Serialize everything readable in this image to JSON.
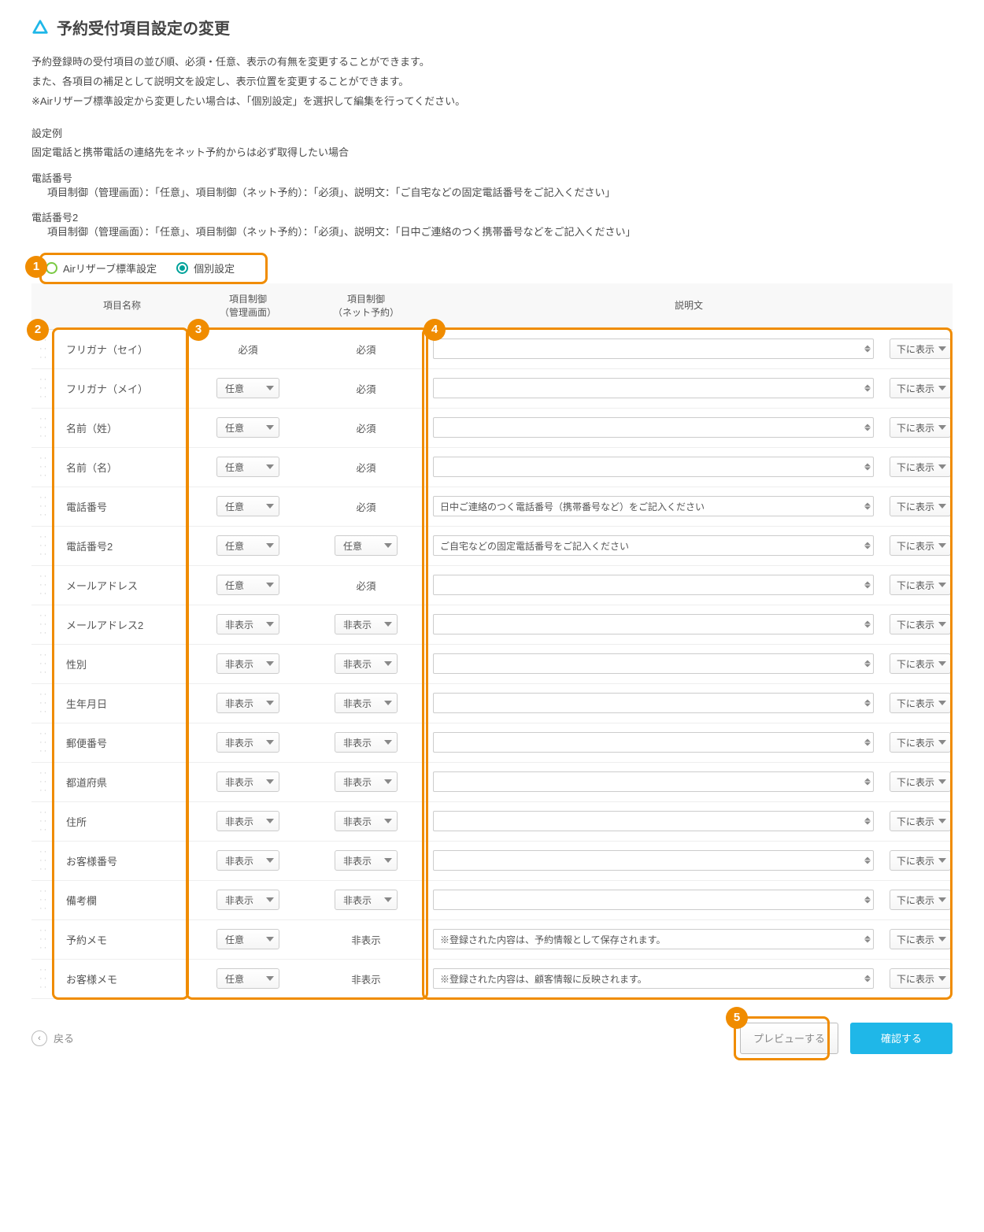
{
  "page_title": "予約受付項目設定の変更",
  "intro_lines": [
    "予約登録時の受付項目の並び順、必須・任意、表示の有無を変更することができます。",
    "また、各項目の補足として説明文を設定し、表示位置を変更することができます。",
    "※Airリザーブ標準設定から変更したい場合は、「個別設定」を選択して編集を行ってください。"
  ],
  "example_heading": "設定例",
  "example_sub": "固定電話と携帯電話の連絡先をネット予約からは必ず取得したい場合",
  "phone_blocks": [
    {
      "title": "電話番号",
      "detail": "項目制御（管理画面）：「任意」、項目制御（ネット予約）：「必須」、説明文：「ご自宅などの固定電話番号をご記入ください」"
    },
    {
      "title": "電話番号2",
      "detail": "項目制御（管理画面）：「任意」、項目制御（ネット予約）：「必須」、説明文：「日中ご連絡のつく携帯番号などをご記入ください」"
    }
  ],
  "radio": {
    "standard": "Airリザーブ標準設定",
    "custom": "個別設定"
  },
  "table_headers": {
    "name": "項目名称",
    "admin": "項目制御\n（管理画面）",
    "net": "項目制御\n（ネット予約）",
    "desc": "説明文"
  },
  "pos_label": "下に表示",
  "rows": [
    {
      "name": "フリガナ（セイ）",
      "admin_type": "static",
      "admin": "必須",
      "net_type": "static",
      "net": "必須",
      "desc": ""
    },
    {
      "name": "フリガナ（メイ）",
      "admin_type": "select",
      "admin": "任意",
      "net_type": "static",
      "net": "必須",
      "desc": ""
    },
    {
      "name": "名前（姓）",
      "admin_type": "select",
      "admin": "任意",
      "net_type": "static",
      "net": "必須",
      "desc": ""
    },
    {
      "name": "名前（名）",
      "admin_type": "select",
      "admin": "任意",
      "net_type": "static",
      "net": "必須",
      "desc": ""
    },
    {
      "name": "電話番号",
      "admin_type": "select",
      "admin": "任意",
      "net_type": "static",
      "net": "必須",
      "desc": "日中ご連絡のつく電話番号（携帯番号など）をご記入ください"
    },
    {
      "name": "電話番号2",
      "admin_type": "select",
      "admin": "任意",
      "net_type": "select",
      "net": "任意",
      "desc": "ご自宅などの固定電話番号をご記入ください"
    },
    {
      "name": "メールアドレス",
      "admin_type": "select",
      "admin": "任意",
      "net_type": "static",
      "net": "必須",
      "desc": ""
    },
    {
      "name": "メールアドレス2",
      "admin_type": "select",
      "admin": "非表示",
      "net_type": "select",
      "net": "非表示",
      "desc": ""
    },
    {
      "name": "性別",
      "admin_type": "select",
      "admin": "非表示",
      "net_type": "select",
      "net": "非表示",
      "desc": ""
    },
    {
      "name": "生年月日",
      "admin_type": "select",
      "admin": "非表示",
      "net_type": "select",
      "net": "非表示",
      "desc": ""
    },
    {
      "name": "郵便番号",
      "admin_type": "select",
      "admin": "非表示",
      "net_type": "select",
      "net": "非表示",
      "desc": ""
    },
    {
      "name": "都道府県",
      "admin_type": "select",
      "admin": "非表示",
      "net_type": "select",
      "net": "非表示",
      "desc": ""
    },
    {
      "name": "住所",
      "admin_type": "select",
      "admin": "非表示",
      "net_type": "select",
      "net": "非表示",
      "desc": ""
    },
    {
      "name": "お客様番号",
      "admin_type": "select",
      "admin": "非表示",
      "net_type": "select",
      "net": "非表示",
      "desc": ""
    },
    {
      "name": "備考欄",
      "admin_type": "select",
      "admin": "非表示",
      "net_type": "select",
      "net": "非表示",
      "desc": ""
    },
    {
      "name": "予約メモ",
      "admin_type": "select",
      "admin": "任意",
      "net_type": "static",
      "net": "非表示",
      "desc": "※登録された内容は、予約情報として保存されます。"
    },
    {
      "name": "お客様メモ",
      "admin_type": "select",
      "admin": "任意",
      "net_type": "static",
      "net": "非表示",
      "desc": "※登録された内容は、顧客情報に反映されます。"
    }
  ],
  "badges": {
    "b1": "1",
    "b2": "2",
    "b3": "3",
    "b4": "4",
    "b5": "5"
  },
  "footer": {
    "back": "戻る",
    "preview": "プレビューする",
    "confirm": "確認する"
  }
}
